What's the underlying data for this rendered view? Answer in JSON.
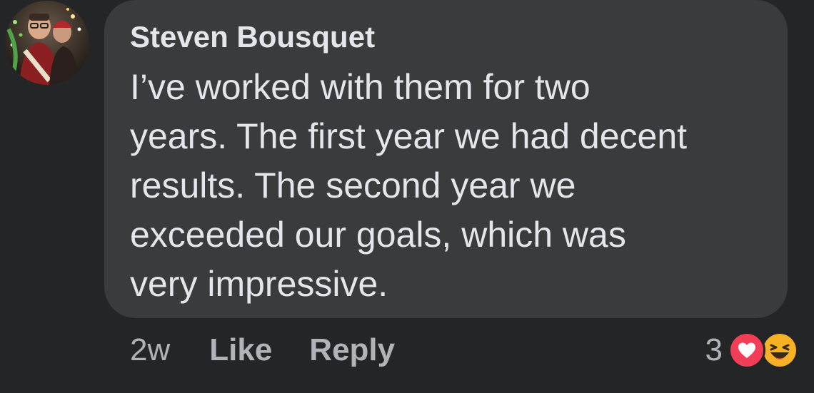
{
  "comment": {
    "author": "Steven Bousquet",
    "body_lines": [
      "I’ve worked with them for two",
      "years. The first year we had decent",
      "results. The second year we",
      "exceeded our goals, which was",
      "very impressive."
    ]
  },
  "actions": {
    "time": "2w",
    "like_label": "Like",
    "reply_label": "Reply"
  },
  "reactions": {
    "count": "3",
    "icons": [
      "heart-icon",
      "haha-icon"
    ]
  },
  "colors": {
    "background": "#242526",
    "bubble": "#3a3b3c",
    "primary_text": "#e4e6eb",
    "secondary_text": "#b0b3b8",
    "love": "#f33e58",
    "haha": "#f7b125"
  }
}
